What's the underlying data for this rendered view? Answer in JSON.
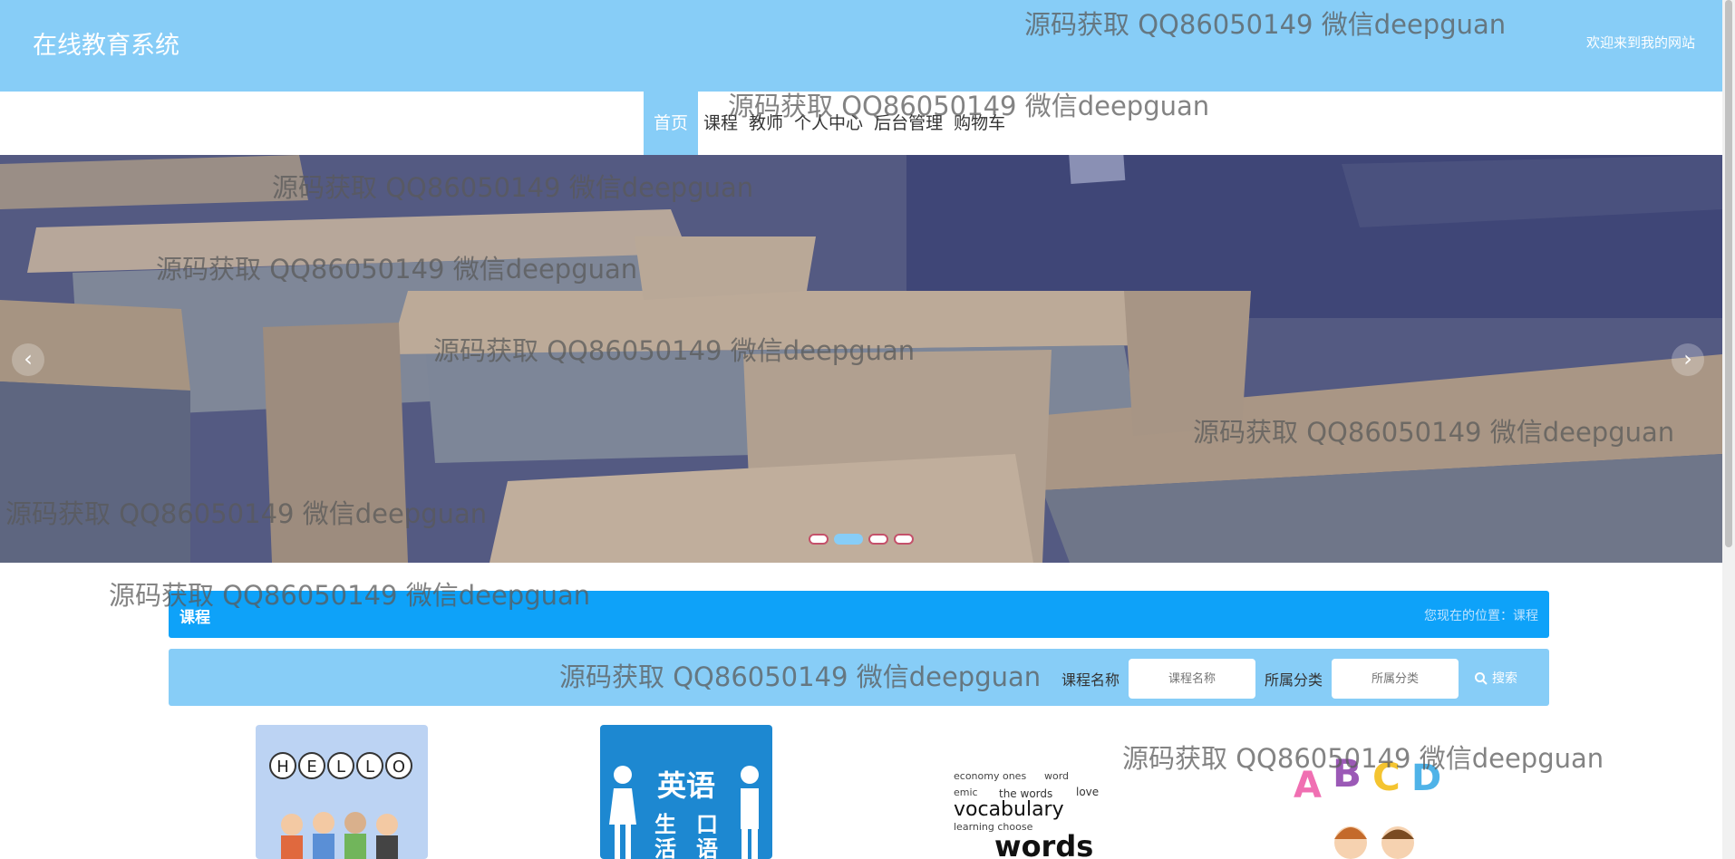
{
  "header": {
    "site_title": "在线教育系统",
    "welcome": "欢迎来到我的网站"
  },
  "nav": {
    "items": [
      "首页",
      "课程",
      "教师",
      "个人中心",
      "后台管理",
      "购物车"
    ],
    "active_index": 0
  },
  "banner": {
    "prev_icon": "chevron-left-icon",
    "next_icon": "chevron-right-icon",
    "slide_count": 4,
    "active_slide": 1
  },
  "section": {
    "title": "课程",
    "breadcrumb": "您现在的位置：课程"
  },
  "search": {
    "name_label": "课程名称",
    "name_placeholder": "课程名称",
    "category_label": "所属分类",
    "category_placeholder": "所属分类",
    "button_label": "搜索"
  },
  "courses": [
    {
      "image_text": "HELLO"
    },
    {
      "image_text": "英语 生活 口语"
    },
    {
      "image_text": "vocabulary words"
    },
    {
      "image_text": "ABCD"
    }
  ],
  "watermark": "源码获取 QQ86050149 微信deepguan",
  "colors": {
    "header_bg": "#87cdf7",
    "section_bg": "#0ea2f9"
  }
}
